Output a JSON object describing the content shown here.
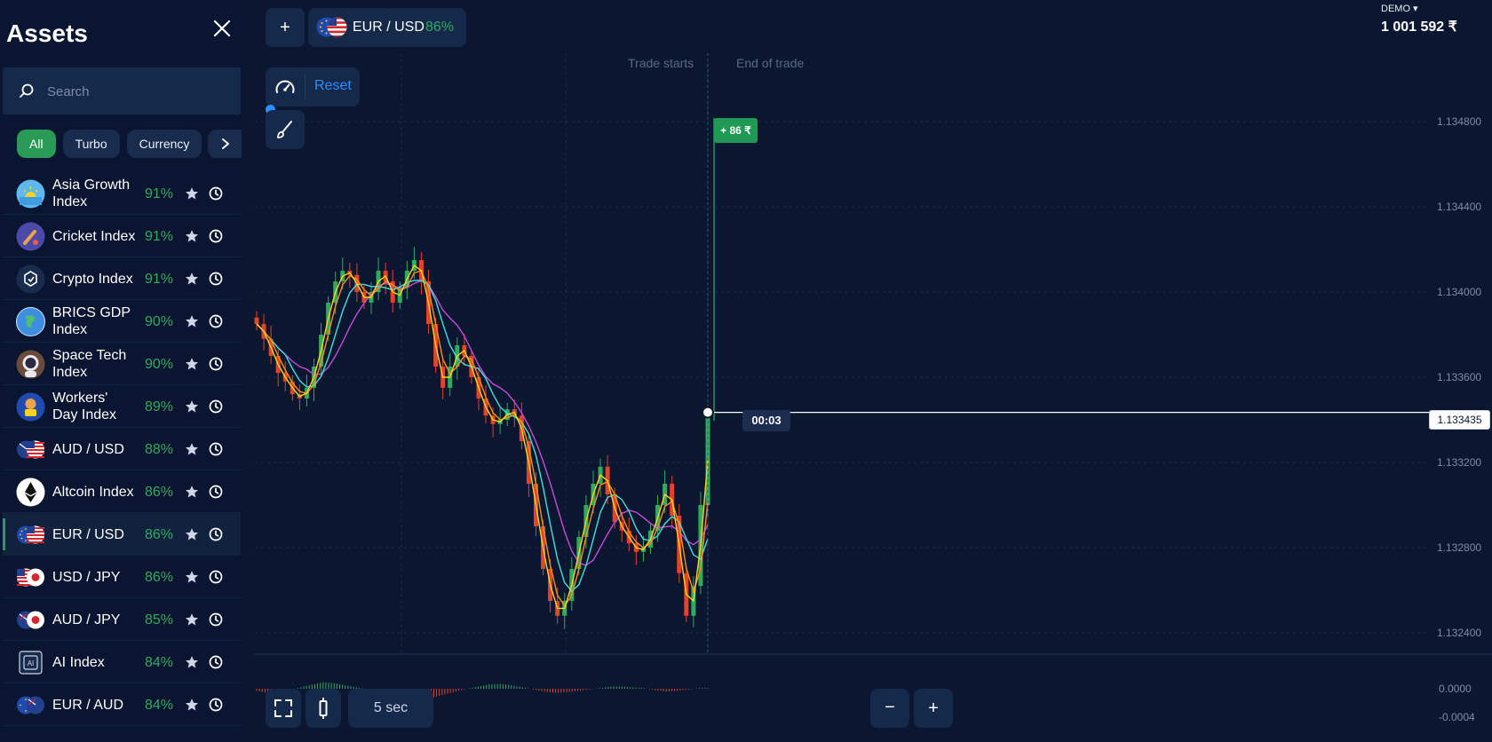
{
  "sidebar": {
    "title": "Assets",
    "search_placeholder": "Search",
    "filters": [
      "All",
      "Turbo",
      "Currency"
    ],
    "assets": [
      {
        "name": "Asia Growth Index",
        "payout": "91%",
        "icon": "sun-icon"
      },
      {
        "name": "Cricket Index",
        "payout": "91%",
        "icon": "cricket-icon"
      },
      {
        "name": "Crypto Index",
        "payout": "91%",
        "icon": "crypto-icon"
      },
      {
        "name": "BRICS GDP Index",
        "payout": "90%",
        "icon": "globe-icon"
      },
      {
        "name": "Space Tech Index",
        "payout": "90%",
        "icon": "astronaut-icon"
      },
      {
        "name": "Workers' Day Index",
        "payout": "89%",
        "icon": "workers-icon"
      },
      {
        "name": "AUD / USD",
        "payout": "88%",
        "icon": "flag-aud-usd-icon"
      },
      {
        "name": "Altcoin Index",
        "payout": "86%",
        "icon": "ethereum-icon"
      },
      {
        "name": "EUR / USD",
        "payout": "86%",
        "icon": "flag-eur-usd-icon",
        "selected": true
      },
      {
        "name": "USD / JPY",
        "payout": "86%",
        "icon": "flag-usd-jpy-icon"
      },
      {
        "name": "AUD / JPY",
        "payout": "85%",
        "icon": "flag-aud-jpy-icon"
      },
      {
        "name": "AI Index",
        "payout": "84%",
        "icon": "ai-chip-icon"
      },
      {
        "name": "EUR / AUD",
        "payout": "84%",
        "icon": "flag-eur-aud-icon"
      }
    ]
  },
  "header": {
    "add_label": "+",
    "asset_name": "EUR / USD",
    "asset_payout": "86%"
  },
  "account": {
    "mode": "DEMO ▾",
    "balance": "1 001 592 ₹"
  },
  "tools": {
    "reset_label": "Reset"
  },
  "chart": {
    "trade_starts_label": "Trade starts",
    "end_of_trade_label": "End of trade",
    "profit_badge": "+ 86 ₹",
    "timer": "00:03",
    "current_price": "1.133435",
    "y_ticks": [
      "1.134800",
      "1.134400",
      "1.134000",
      "1.133600",
      "1.133200",
      "1.132800",
      "1.132400"
    ],
    "osc_ticks": [
      "0.0000",
      "-0.0004"
    ],
    "colors": {
      "bullish": "#2faa5f",
      "bearish": "#e0442b",
      "ma_fast": "#ffd21f",
      "ma_mid": "#ff8c1a",
      "ma_cyan": "#3fe0e0",
      "ma_slow": "#c84ad8"
    }
  },
  "chart_data": {
    "type": "candlestick",
    "series_price": [
      1.13385,
      1.13378,
      1.1337,
      1.13362,
      1.13358,
      1.13352,
      1.1335,
      1.13355,
      1.13365,
      1.1338,
      1.13395,
      1.13405,
      1.1341,
      1.13408,
      1.134,
      1.13395,
      1.134,
      1.1341,
      1.13405,
      1.13395,
      1.13402,
      1.1341,
      1.13415,
      1.13405,
      1.13385,
      1.13365,
      1.13355,
      1.13365,
      1.13375,
      1.1337,
      1.1336,
      1.1335,
      1.13342,
      1.13338,
      1.1334,
      1.13345,
      1.13342,
      1.1333,
      1.1331,
      1.1329,
      1.1327,
      1.13255,
      1.13248,
      1.13255,
      1.1327,
      1.13285,
      1.133,
      1.1331,
      1.13318,
      1.13305,
      1.13292,
      1.13288,
      1.13282,
      1.13278,
      1.1328,
      1.13288,
      1.133,
      1.1331,
      1.13295,
      1.13268,
      1.13248,
      1.13262,
      1.133,
      1.13343
    ],
    "ylim": [
      1.1322,
      1.1349
    ],
    "current_price": 1.133435,
    "oscillator": [
      -3e-05,
      -6e-05,
      -5e-05,
      -2e-05,
      2e-05,
      6e-05,
      9e-05,
      8e-05,
      5e-05,
      2e-05,
      -1e-05,
      -3e-05,
      -6e-05,
      -9e-05,
      -0.00012,
      -0.00014,
      -0.00012,
      -8e-05,
      -4e-05,
      0.0,
      3e-05,
      6e-05,
      7e-05,
      5e-05,
      2e-05,
      -1e-05,
      -4e-05,
      -6e-05,
      -5e-05,
      -3e-05,
      -1e-05,
      1e-05,
      3e-05,
      3e-05,
      2e-05,
      1e-05,
      -2e-05,
      -4e-05,
      -3e-05,
      -1e-05,
      1e-05
    ]
  },
  "bottom": {
    "period_label": "5 sec",
    "zoom_out_label": "−",
    "zoom_in_label": "+"
  }
}
